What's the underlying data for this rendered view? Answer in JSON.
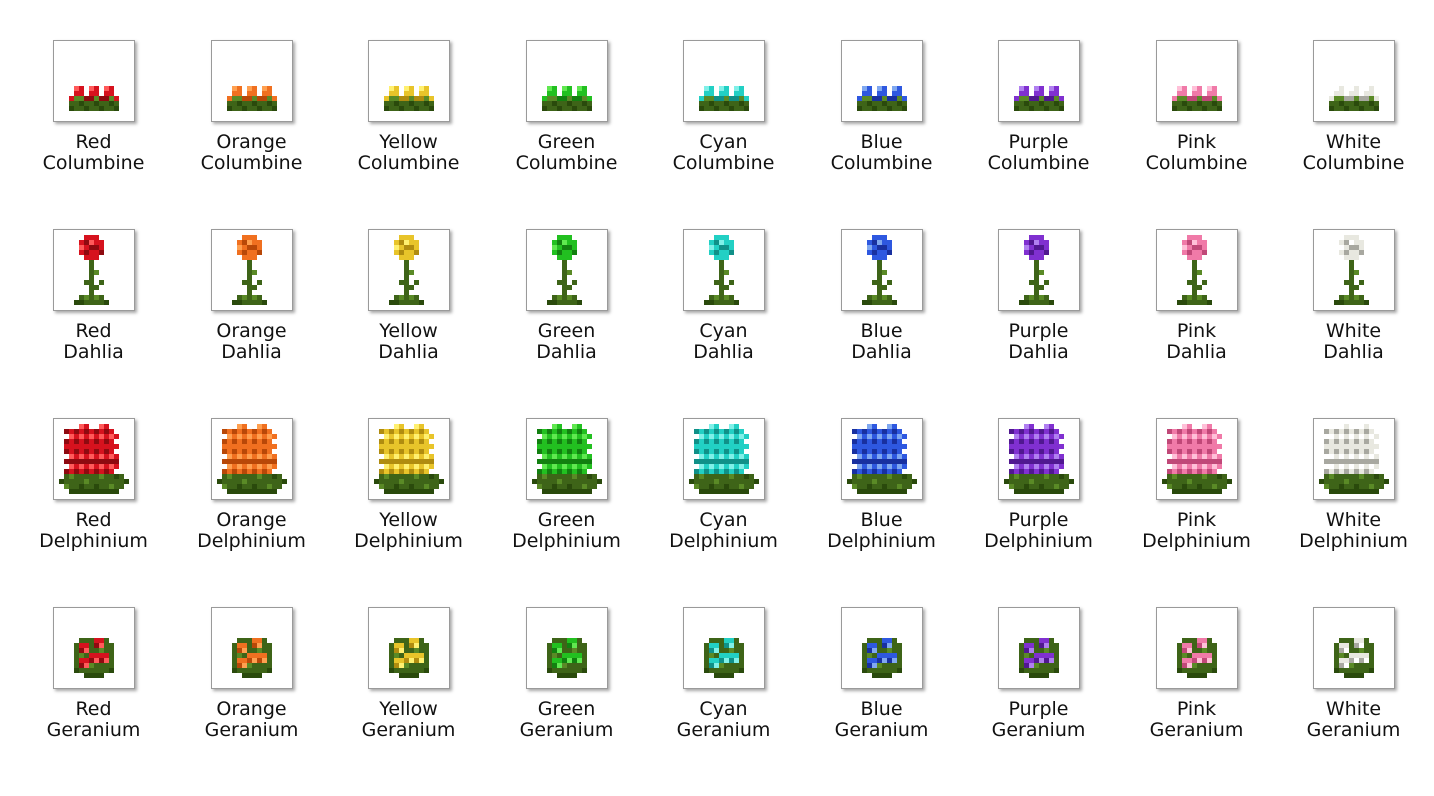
{
  "colors": [
    {
      "name": "Red",
      "main": "#d6121e",
      "dark": "#8e0a10",
      "light": "#ff5a5a"
    },
    {
      "name": "Orange",
      "main": "#f07020",
      "dark": "#b84808",
      "light": "#ffa050"
    },
    {
      "name": "Yellow",
      "main": "#e8c42a",
      "dark": "#b08c10",
      "light": "#fff070"
    },
    {
      "name": "Green",
      "main": "#22c020",
      "dark": "#128010",
      "light": "#60e850"
    },
    {
      "name": "Cyan",
      "main": "#22d0c4",
      "dark": "#109088",
      "light": "#80f0e8"
    },
    {
      "name": "Blue",
      "main": "#2e58e0",
      "dark": "#1830a0",
      "light": "#80a8f0"
    },
    {
      "name": "Purple",
      "main": "#8030d0",
      "dark": "#501890",
      "light": "#b080f0"
    },
    {
      "name": "Pink",
      "main": "#f07aa8",
      "dark": "#c04878",
      "light": "#ffc0d8"
    },
    {
      "name": "White",
      "main": "#e8e8e0",
      "dark": "#a8a8a0",
      "light": "#ffffff"
    }
  ],
  "leaf_colors": {
    "dark": "#2a4a0c",
    "mid": "#3e6418",
    "light": "#5a8a26"
  },
  "rows": [
    {
      "type": "columbine",
      "items": [
        {
          "line1": "Red",
          "line2": "Columbine"
        },
        {
          "line1": "Orange",
          "line2": "Columbine"
        },
        {
          "line1": "Yellow",
          "line2": "Columbine"
        },
        {
          "line1": "Green",
          "line2": "Columbine"
        },
        {
          "line1": "Cyan",
          "line2": "Columbine"
        },
        {
          "line1": "Blue",
          "line2": "Columbine"
        },
        {
          "line1": "Purple",
          "line2": "Columbine"
        },
        {
          "line1": "Pink",
          "line2": "Columbine"
        },
        {
          "line1": "White",
          "line2": "Columbine"
        }
      ]
    },
    {
      "type": "dahlia",
      "items": [
        {
          "line1": "Red",
          "line2": "Dahlia"
        },
        {
          "line1": "Orange",
          "line2": "Dahlia"
        },
        {
          "line1": "Yellow",
          "line2": "Dahlia"
        },
        {
          "line1": "Green",
          "line2": "Dahlia"
        },
        {
          "line1": "Cyan",
          "line2": "Dahlia"
        },
        {
          "line1": "Blue",
          "line2": "Dahlia"
        },
        {
          "line1": "Purple",
          "line2": "Dahlia"
        },
        {
          "line1": "Pink",
          "line2": "Dahlia"
        },
        {
          "line1": "White",
          "line2": "Dahlia"
        }
      ]
    },
    {
      "type": "delphinium",
      "items": [
        {
          "line1": "Red",
          "line2": "Delphinium"
        },
        {
          "line1": "Orange",
          "line2": "Delphinium"
        },
        {
          "line1": "Yellow",
          "line2": "Delphinium"
        },
        {
          "line1": "Green",
          "line2": "Delphinium"
        },
        {
          "line1": "Cyan",
          "line2": "Delphinium"
        },
        {
          "line1": "Blue",
          "line2": "Delphinium"
        },
        {
          "line1": "Purple",
          "line2": "Delphinium"
        },
        {
          "line1": "Pink",
          "line2": "Delphinium"
        },
        {
          "line1": "White",
          "line2": "Delphinium"
        }
      ]
    },
    {
      "type": "geranium",
      "items": [
        {
          "line1": "Red",
          "line2": "Geranium"
        },
        {
          "line1": "Orange",
          "line2": "Geranium"
        },
        {
          "line1": "Yellow",
          "line2": "Geranium"
        },
        {
          "line1": "Green",
          "line2": "Geranium"
        },
        {
          "line1": "Cyan",
          "line2": "Geranium"
        },
        {
          "line1": "Blue",
          "line2": "Geranium"
        },
        {
          "line1": "Purple",
          "line2": "Geranium"
        },
        {
          "line1": "Pink",
          "line2": "Geranium"
        },
        {
          "line1": "White",
          "line2": "Geranium"
        }
      ]
    }
  ]
}
